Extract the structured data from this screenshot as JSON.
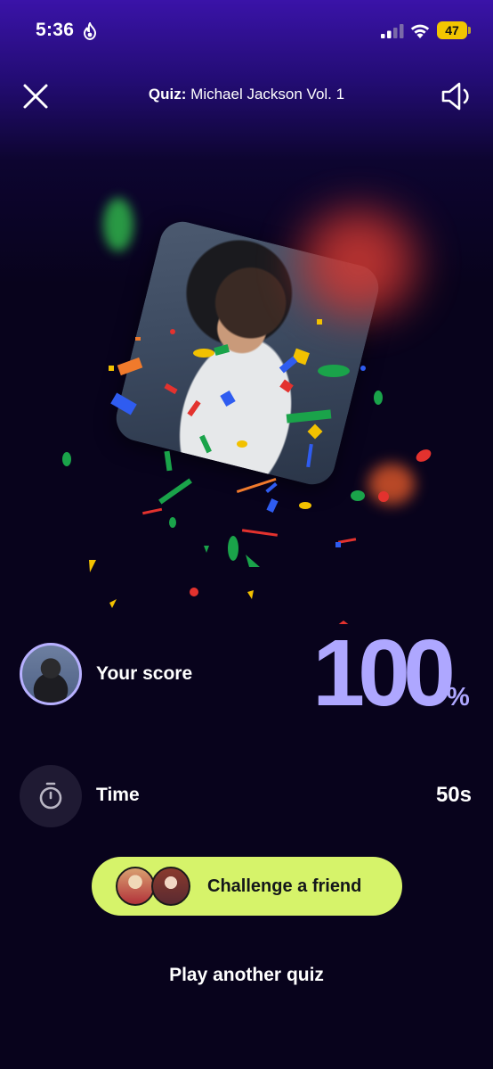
{
  "status_bar": {
    "time": "5:36",
    "battery": "47"
  },
  "header": {
    "title_label": "Quiz:",
    "title_name": "Michael Jackson Vol. 1"
  },
  "result": {
    "score_label": "Your score",
    "score_value": "100",
    "score_unit": "%",
    "time_label": "Time",
    "time_value": "50s"
  },
  "actions": {
    "challenge_label": "Challenge a friend",
    "play_another_label": "Play another quiz"
  },
  "colors": {
    "accent_lavender": "#aea7ff",
    "challenge_green": "#d6f36a",
    "background": "#08031c"
  }
}
